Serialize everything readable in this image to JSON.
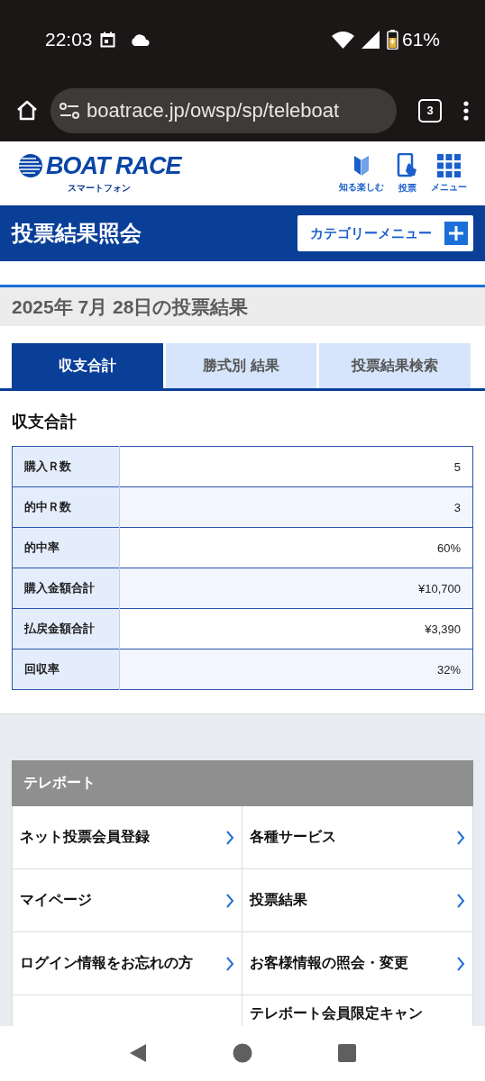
{
  "status_bar": {
    "time": "22:03",
    "battery": "61%"
  },
  "browser": {
    "url": "boatrace.jp/owsp/sp/teleboat",
    "tab_count": "3"
  },
  "header": {
    "logo": "BOAT RACE",
    "logo_sub": "スマートフォン",
    "nav": [
      {
        "kind": "guide",
        "label": "知る楽しむ"
      },
      {
        "kind": "vote",
        "label": "投票"
      },
      {
        "kind": "menu",
        "label": "メニュー"
      }
    ]
  },
  "title_bar": {
    "title": "投票結果照会",
    "category_button": "カテゴリーメニュー"
  },
  "date_heading": "2025年 7月 28日の投票結果",
  "tabs": [
    {
      "label": "収支合計",
      "selected": true
    },
    {
      "label": "勝式別 結果",
      "selected": false
    },
    {
      "label": "投票結果検索",
      "selected": false
    }
  ],
  "section_title": "収支合計",
  "summary": [
    {
      "label": "購入Ｒ数",
      "value": "5"
    },
    {
      "label": "的中Ｒ数",
      "value": "3"
    },
    {
      "label": "的中率",
      "value": "60%"
    },
    {
      "label": "購入金額合計",
      "value": "¥10,700"
    },
    {
      "label": "払戻金額合計",
      "value": "¥3,390"
    },
    {
      "label": "回収率",
      "value": "32%"
    }
  ],
  "teleboat": {
    "title": "テレボート",
    "rows": [
      {
        "left": "ネット投票会員登録",
        "right": "各種サービス"
      },
      {
        "left": "マイページ",
        "right": "投票結果"
      },
      {
        "left": "ログイン情報をお忘れの方",
        "right": "お客様情報の照会・変更"
      },
      {
        "right": "テレボート会員限定キャン"
      }
    ]
  }
}
